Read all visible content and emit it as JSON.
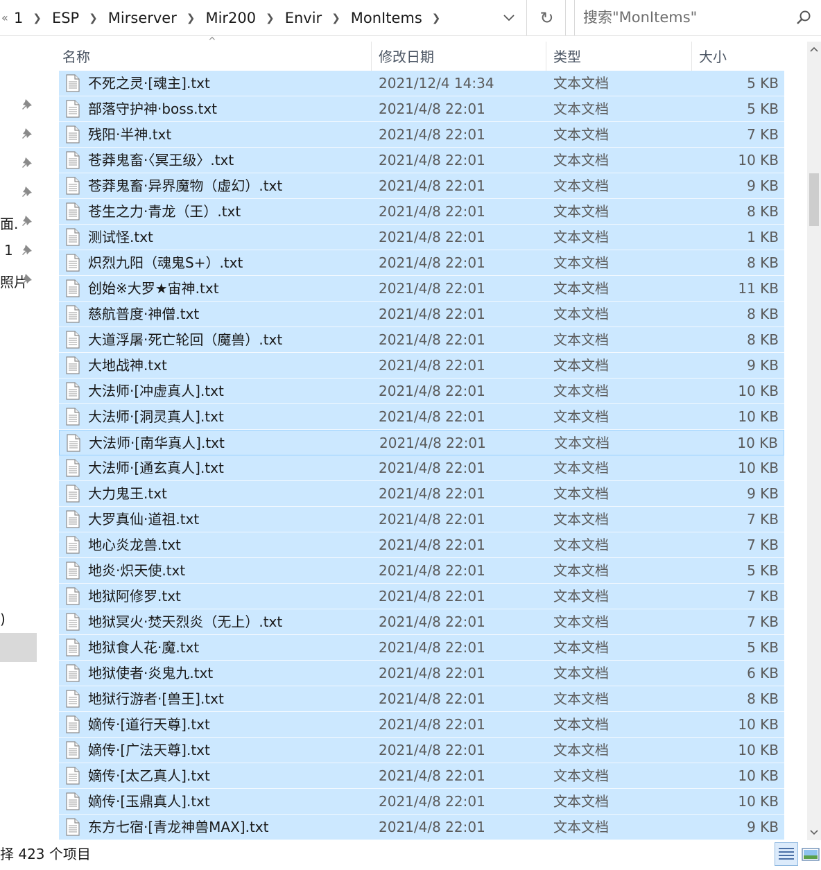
{
  "breadcrumb": {
    "overflow": "«",
    "items": [
      "1",
      "ESP",
      "Mirserver",
      "Mir200",
      "Envir",
      "MonItems"
    ]
  },
  "search": {
    "placeholder": "搜索\"MonItems\""
  },
  "nav": {
    "labels": [
      "面.",
      "1",
      "照片",
      ")"
    ]
  },
  "columns": {
    "name": "名称",
    "date": "修改日期",
    "type": "类型",
    "size": "大小"
  },
  "files": [
    {
      "name": "不死之灵·[魂主].txt",
      "date": "2021/12/4 14:34",
      "type": "文本文档",
      "size": "5 KB"
    },
    {
      "name": "部落守护神·boss.txt",
      "date": "2021/4/8 22:01",
      "type": "文本文档",
      "size": "5 KB"
    },
    {
      "name": "残阳·半神.txt",
      "date": "2021/4/8 22:01",
      "type": "文本文档",
      "size": "7 KB"
    },
    {
      "name": "苍莽鬼畜·〈冥王级〉.txt",
      "date": "2021/4/8 22:01",
      "type": "文本文档",
      "size": "10 KB"
    },
    {
      "name": "苍莽鬼畜·异界魔物（虚幻）.txt",
      "date": "2021/4/8 22:01",
      "type": "文本文档",
      "size": "9 KB"
    },
    {
      "name": "苍生之力·青龙（王）.txt",
      "date": "2021/4/8 22:01",
      "type": "文本文档",
      "size": "8 KB"
    },
    {
      "name": "测试怪.txt",
      "date": "2021/4/8 22:01",
      "type": "文本文档",
      "size": "1 KB"
    },
    {
      "name": "炽烈九阳（魂鬼S+）.txt",
      "date": "2021/4/8 22:01",
      "type": "文本文档",
      "size": "8 KB"
    },
    {
      "name": "创始※大罗★宙神.txt",
      "date": "2021/4/8 22:01",
      "type": "文本文档",
      "size": "11 KB"
    },
    {
      "name": "慈航普度·神僧.txt",
      "date": "2021/4/8 22:01",
      "type": "文本文档",
      "size": "8 KB"
    },
    {
      "name": "大道浮屠·死亡轮回（魔兽）.txt",
      "date": "2021/4/8 22:01",
      "type": "文本文档",
      "size": "8 KB"
    },
    {
      "name": "大地战神.txt",
      "date": "2021/4/8 22:01",
      "type": "文本文档",
      "size": "9 KB"
    },
    {
      "name": "大法师·[冲虚真人].txt",
      "date": "2021/4/8 22:01",
      "type": "文本文档",
      "size": "10 KB"
    },
    {
      "name": "大法师·[洞灵真人].txt",
      "date": "2021/4/8 22:01",
      "type": "文本文档",
      "size": "10 KB"
    },
    {
      "name": "大法师·[南华真人].txt",
      "date": "2021/4/8 22:01",
      "type": "文本文档",
      "size": "10 KB"
    },
    {
      "name": "大法师·[通玄真人].txt",
      "date": "2021/4/8 22:01",
      "type": "文本文档",
      "size": "10 KB"
    },
    {
      "name": "大力鬼王.txt",
      "date": "2021/4/8 22:01",
      "type": "文本文档",
      "size": "9 KB"
    },
    {
      "name": "大罗真仙·道祖.txt",
      "date": "2021/4/8 22:01",
      "type": "文本文档",
      "size": "7 KB"
    },
    {
      "name": "地心炎龙兽.txt",
      "date": "2021/4/8 22:01",
      "type": "文本文档",
      "size": "7 KB"
    },
    {
      "name": "地炎·炽天使.txt",
      "date": "2021/4/8 22:01",
      "type": "文本文档",
      "size": "5 KB"
    },
    {
      "name": "地狱阿修罗.txt",
      "date": "2021/4/8 22:01",
      "type": "文本文档",
      "size": "7 KB"
    },
    {
      "name": "地狱冥火·焚天烈炎（无上）.txt",
      "date": "2021/4/8 22:01",
      "type": "文本文档",
      "size": "7 KB"
    },
    {
      "name": "地狱食人花·魔.txt",
      "date": "2021/4/8 22:01",
      "type": "文本文档",
      "size": "5 KB"
    },
    {
      "name": "地狱使者·炎鬼九.txt",
      "date": "2021/4/8 22:01",
      "type": "文本文档",
      "size": "6 KB"
    },
    {
      "name": "地狱行游者·[兽王].txt",
      "date": "2021/4/8 22:01",
      "type": "文本文档",
      "size": "8 KB"
    },
    {
      "name": "嫡传·[道行天尊].txt",
      "date": "2021/4/8 22:01",
      "type": "文本文档",
      "size": "10 KB"
    },
    {
      "name": "嫡传·[广法天尊].txt",
      "date": "2021/4/8 22:01",
      "type": "文本文档",
      "size": "10 KB"
    },
    {
      "name": "嫡传·[太乙真人].txt",
      "date": "2021/4/8 22:01",
      "type": "文本文档",
      "size": "10 KB"
    },
    {
      "name": "嫡传·[玉鼎真人].txt",
      "date": "2021/4/8 22:01",
      "type": "文本文档",
      "size": "10 KB"
    },
    {
      "name": "东方七宿·[青龙神兽MAX].txt",
      "date": "2021/4/8 22:01",
      "type": "文本文档",
      "size": "9 KB"
    }
  ],
  "status": {
    "text": "择 423 个项目"
  },
  "colors": {
    "selection": "#cce8ff",
    "focus_border": "#99d1ff",
    "header_text": "#4b5563"
  },
  "icons": [
    "chevron-right-icon",
    "chevron-down-icon",
    "refresh-icon",
    "search-icon",
    "pin-icon",
    "text-file-icon",
    "details-view-icon",
    "large-icons-view-icon"
  ]
}
